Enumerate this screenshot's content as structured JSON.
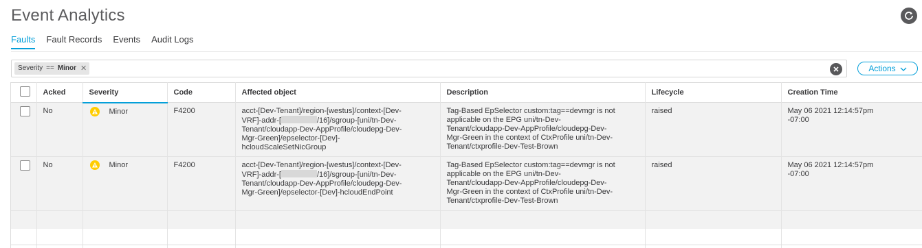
{
  "page": {
    "title": "Event Analytics",
    "refresh_icon": "refresh-icon"
  },
  "tabs": [
    {
      "label": "Faults",
      "active": true
    },
    {
      "label": "Fault Records",
      "active": false
    },
    {
      "label": "Events",
      "active": false
    },
    {
      "label": "Audit Logs",
      "active": false
    }
  ],
  "filter": {
    "chip": {
      "field": "Severity",
      "operator": "==",
      "value": "Minor"
    },
    "clear_icon": "clear-icon"
  },
  "actions": {
    "label": "Actions"
  },
  "table": {
    "columns": [
      "Acked",
      "Severity",
      "Code",
      "Affected object",
      "Description",
      "Lifecycle",
      "Creation Time"
    ],
    "rows": [
      {
        "acked": "No",
        "severity": "Minor",
        "code": "F4200",
        "affected": {
          "l1": "acct-[Dev-Tenant]/region-[westus]/context-[Dev-",
          "l2_pre": "VRF]-addr-[",
          "l2_post": "/16]/sgroup-[uni/tn-Dev-",
          "l3": "Tenant/cloudapp-Dev-AppProfile/cloudepg-Dev-",
          "l4": "Mgr-Green]/epselector-[Dev]-",
          "l5": "hcloudScaleSetNicGroup"
        },
        "description": {
          "l1": "Tag-Based EpSelector custom:tag==devmgr is not",
          "l2": "applicable on the EPG uni/tn-Dev-",
          "l3": "Tenant/cloudapp-Dev-AppProfile/cloudepg-Dev-",
          "l4": "Mgr-Green in the context of CtxProfile uni/tn-Dev-",
          "l5": "Tenant/ctxprofile-Dev-Test-Brown"
        },
        "lifecycle": "raised",
        "created": {
          "l1": "May 06 2021 12:14:57pm",
          "l2": "-07:00"
        }
      },
      {
        "acked": "No",
        "severity": "Minor",
        "code": "F4200",
        "affected": {
          "l1": "acct-[Dev-Tenant]/region-[westus]/context-[Dev-",
          "l2_pre": "VRF]-addr-[",
          "l2_post": "/16]/sgroup-[uni/tn-Dev-",
          "l3": "Tenant/cloudapp-Dev-AppProfile/cloudepg-Dev-",
          "l4": "Mgr-Green]/epselector-[Dev]-hcloudEndPoint"
        },
        "description": {
          "l1": "Tag-Based EpSelector custom:tag==devmgr is not",
          "l2": "applicable on the EPG uni/tn-Dev-",
          "l3": "Tenant/cloudapp-Dev-AppProfile/cloudepg-Dev-",
          "l4": "Mgr-Green in the context of CtxProfile uni/tn-Dev-",
          "l5": "Tenant/ctxprofile-Dev-Test-Brown"
        },
        "lifecycle": "raised",
        "created": {
          "l1": "May 06 2021 12:14:57pm",
          "l2": "-07:00"
        }
      }
    ]
  },
  "colors": {
    "accent": "#049fd9",
    "warning": "#ffcc00",
    "row_bg": "#f2f2f2"
  }
}
